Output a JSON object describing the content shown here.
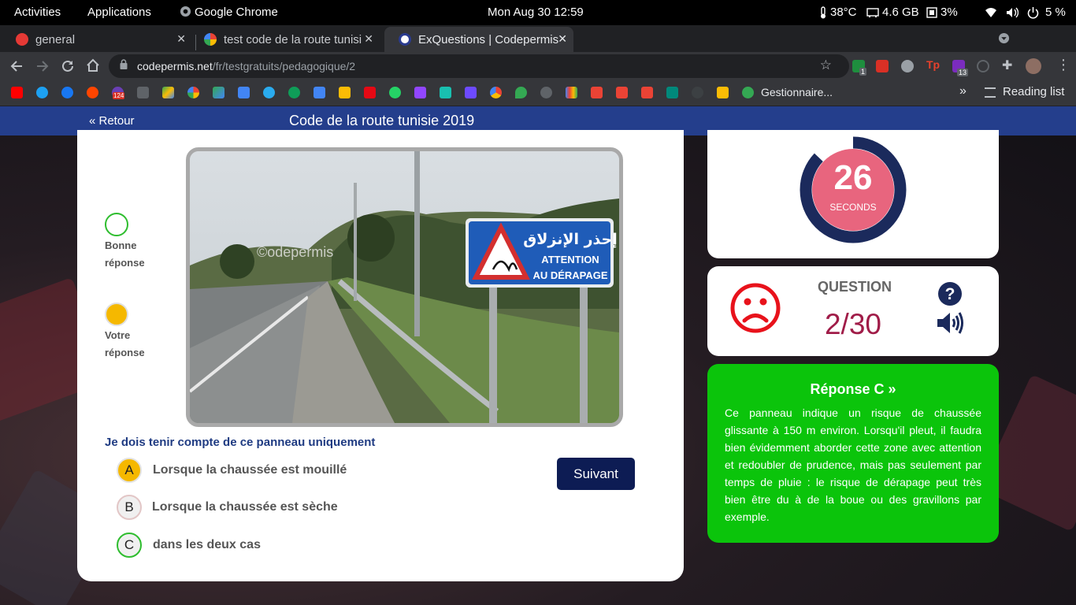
{
  "os_bar": {
    "activities": "Activities",
    "applications": "Applications",
    "app_name": "Google Chrome",
    "clock": "Mon Aug 30  12:59",
    "temperature": "38°C",
    "memory": "4.6 GB",
    "cpu": "3%",
    "battery": "5 %"
  },
  "tabs": [
    {
      "title": "general",
      "favicon_color": "#e53935"
    },
    {
      "title": "test code de la route tunisi",
      "favicon_color": "#4285f4"
    },
    {
      "title": "ExQuestions | Codepermis",
      "favicon_color": "#2a3b8f"
    }
  ],
  "address_bar": {
    "url_host": "codepermis.net",
    "url_path": "/fr/testgratuits/pedagogique/2"
  },
  "extensions": {
    "badge_1": "1",
    "badge_2": "13"
  },
  "bookmarks": {
    "icon_count_badge": "124",
    "gestionnaire": "Gestionnaire...",
    "more": "»",
    "reading_list": "Reading list"
  },
  "page": {
    "back_label": "« Retour",
    "title": "Code de la route tunisie 2019",
    "legend": {
      "correct_line1": "Bonne",
      "correct_line2": "réponse",
      "yours_line1": "Votre",
      "yours_line2": "réponse",
      "correct_color": "#2ebd2e",
      "yours_color": "#f5b800"
    },
    "image": {
      "watermark": "©odepermis",
      "sign_arabic": "إحذر الإنزلاق",
      "sign_line1": "ATTENTION",
      "sign_line2": "AU DÉRAPAGE"
    },
    "question": "Je dois tenir compte de ce panneau uniquement",
    "options": [
      {
        "letter": "A",
        "text": "Lorsque la chaussée est mouillé",
        "state": "selected"
      },
      {
        "letter": "B",
        "text": "Lorsque la chaussée est sèche",
        "state": "neutral"
      },
      {
        "letter": "C",
        "text": "dans les deux cas",
        "state": "correct"
      }
    ],
    "next_button": "Suivant"
  },
  "timer": {
    "value": "26",
    "unit": "SECONDS",
    "remaining_fraction": 0.87,
    "ring_color": "#1b2a5c",
    "fill_color": "#e8657e"
  },
  "question_status": {
    "label": "QUESTION",
    "counter": "2/30",
    "mood_icon": "sad-face-icon",
    "mood_color": "#e8121b"
  },
  "answer": {
    "title": "Réponse C »",
    "body": "Ce panneau indique un risque de chaussée glissante à 150 m environ. Lorsqu'il pleut, il faudra bien évidemment aborder cette zone avec attention et redoubler de prudence, mais pas seulement par temps de pluie : le risque de dérapage peut très bien être du à de la boue ou des gravillons par exemple.",
    "background_color": "#0bc40b"
  }
}
